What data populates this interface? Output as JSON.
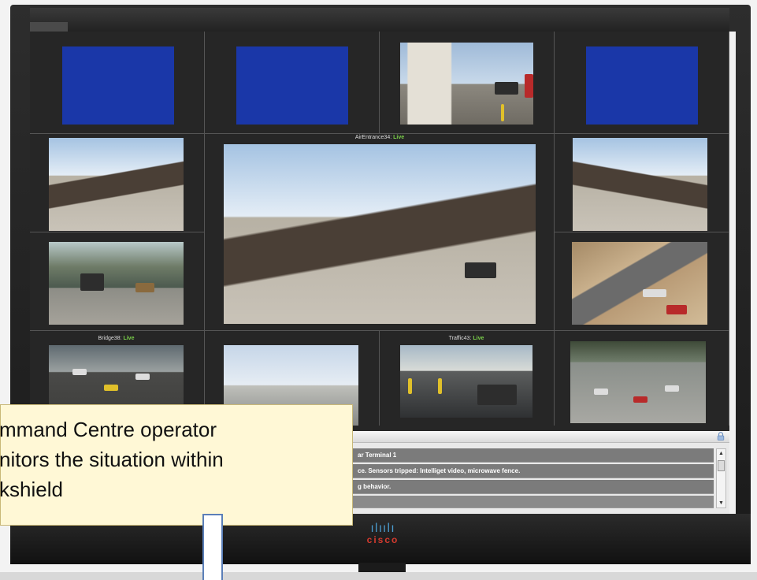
{
  "cameras": {
    "main": {
      "name": "AirEntrance34:",
      "status": "Live"
    },
    "bridge": {
      "name": "Bridge38:",
      "status": "Live"
    },
    "traffic": {
      "name": "Traffic43:",
      "status": "Live"
    }
  },
  "events": {
    "rows": [
      "ar Terminal 1",
      "ce. Sensors tripped: Intelliget video, microwave fence.",
      "g behavior."
    ]
  },
  "callout": {
    "text": "mmand Centre operator\nnitors the situation within\nkshield"
  },
  "brand": {
    "bars": "ılıılı",
    "name": "cisco"
  },
  "icons": {
    "lock": "lock-icon",
    "scroll_up": "scroll-up-icon",
    "scroll_down": "scroll-down-icon"
  },
  "colors": {
    "live": "#7bd14a",
    "no_signal": "#1a37a8",
    "callout_bg": "#fff8d6",
    "cisco_red": "#d33a2e",
    "cisco_blue": "#4b9ccf"
  }
}
